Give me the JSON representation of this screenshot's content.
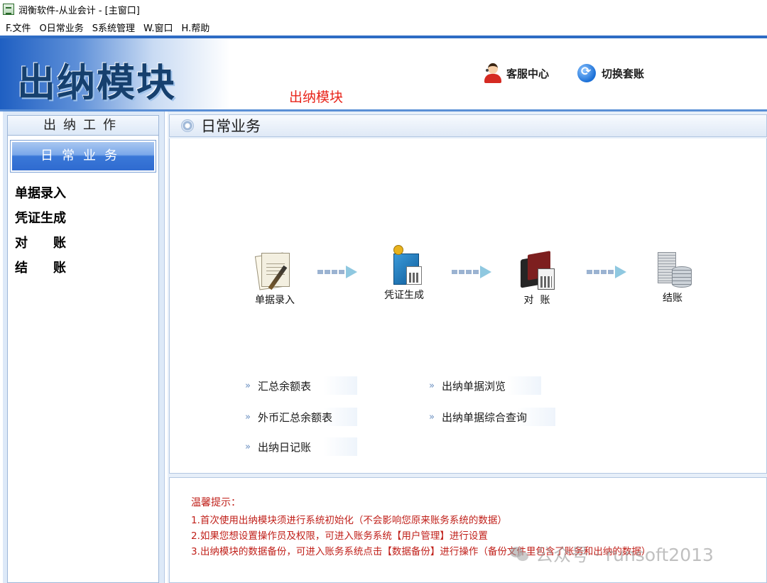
{
  "window": {
    "title": "润衡软件-从业会计 - [主窗口]"
  },
  "menu": [
    {
      "label": "F.文件"
    },
    {
      "label": "O日常业务"
    },
    {
      "label": "S系统管理"
    },
    {
      "label": "W.窗口"
    },
    {
      "label": "H.帮助"
    }
  ],
  "banner": {
    "logo_text": "出纳模块",
    "caption": "出纳模块",
    "caption_color": "#e8251b",
    "service_label": "客服中心",
    "service_icon": "customer-service-icon",
    "switch_label": "切换套账",
    "switch_icon": "switch-refresh-icon"
  },
  "sidebar": {
    "header": "出纳工作",
    "active_tab": "日常业务",
    "items": [
      {
        "label": "单据录入"
      },
      {
        "label": "凭证生成"
      },
      {
        "label": "对　　账"
      },
      {
        "label": "结　　账"
      }
    ]
  },
  "main": {
    "title": "日常业务",
    "workflow": [
      {
        "label": "单据录入",
        "icon": "documents-pen-icon"
      },
      {
        "label": "凭证生成",
        "icon": "voucher-calculator-icon"
      },
      {
        "label": "对  账",
        "icon": "books-calculator-icon"
      },
      {
        "label": "结账",
        "icon": "paper-coins-icon"
      }
    ],
    "reports": [
      {
        "label": "汇总余额表"
      },
      {
        "label": "出纳单据浏览"
      },
      {
        "label": "外币汇总余额表"
      },
      {
        "label": "出纳单据综合查询"
      },
      {
        "label": "出纳日记账"
      }
    ]
  },
  "tips": {
    "title": "温馨提示：",
    "lines": [
      "1.首次使用出纳模块须进行系统初始化（不会影响您原来账务系统的数据）",
      "2.如果您想设置操作员及权限，可进入账务系统【用户管理】进行设置",
      "3.出纳模块的数据备份，可进入账务系统点击【数据备份】进行操作（备份文件里包含了账务和出纳的数据）"
    ],
    "color": "#c0201a"
  },
  "watermark": {
    "text": "公众号 · runsoft2013"
  },
  "colors": {
    "accent": "#2e6cc4",
    "panel_bg": "#e7eff9",
    "tab_blue": "#2f6bd0"
  }
}
